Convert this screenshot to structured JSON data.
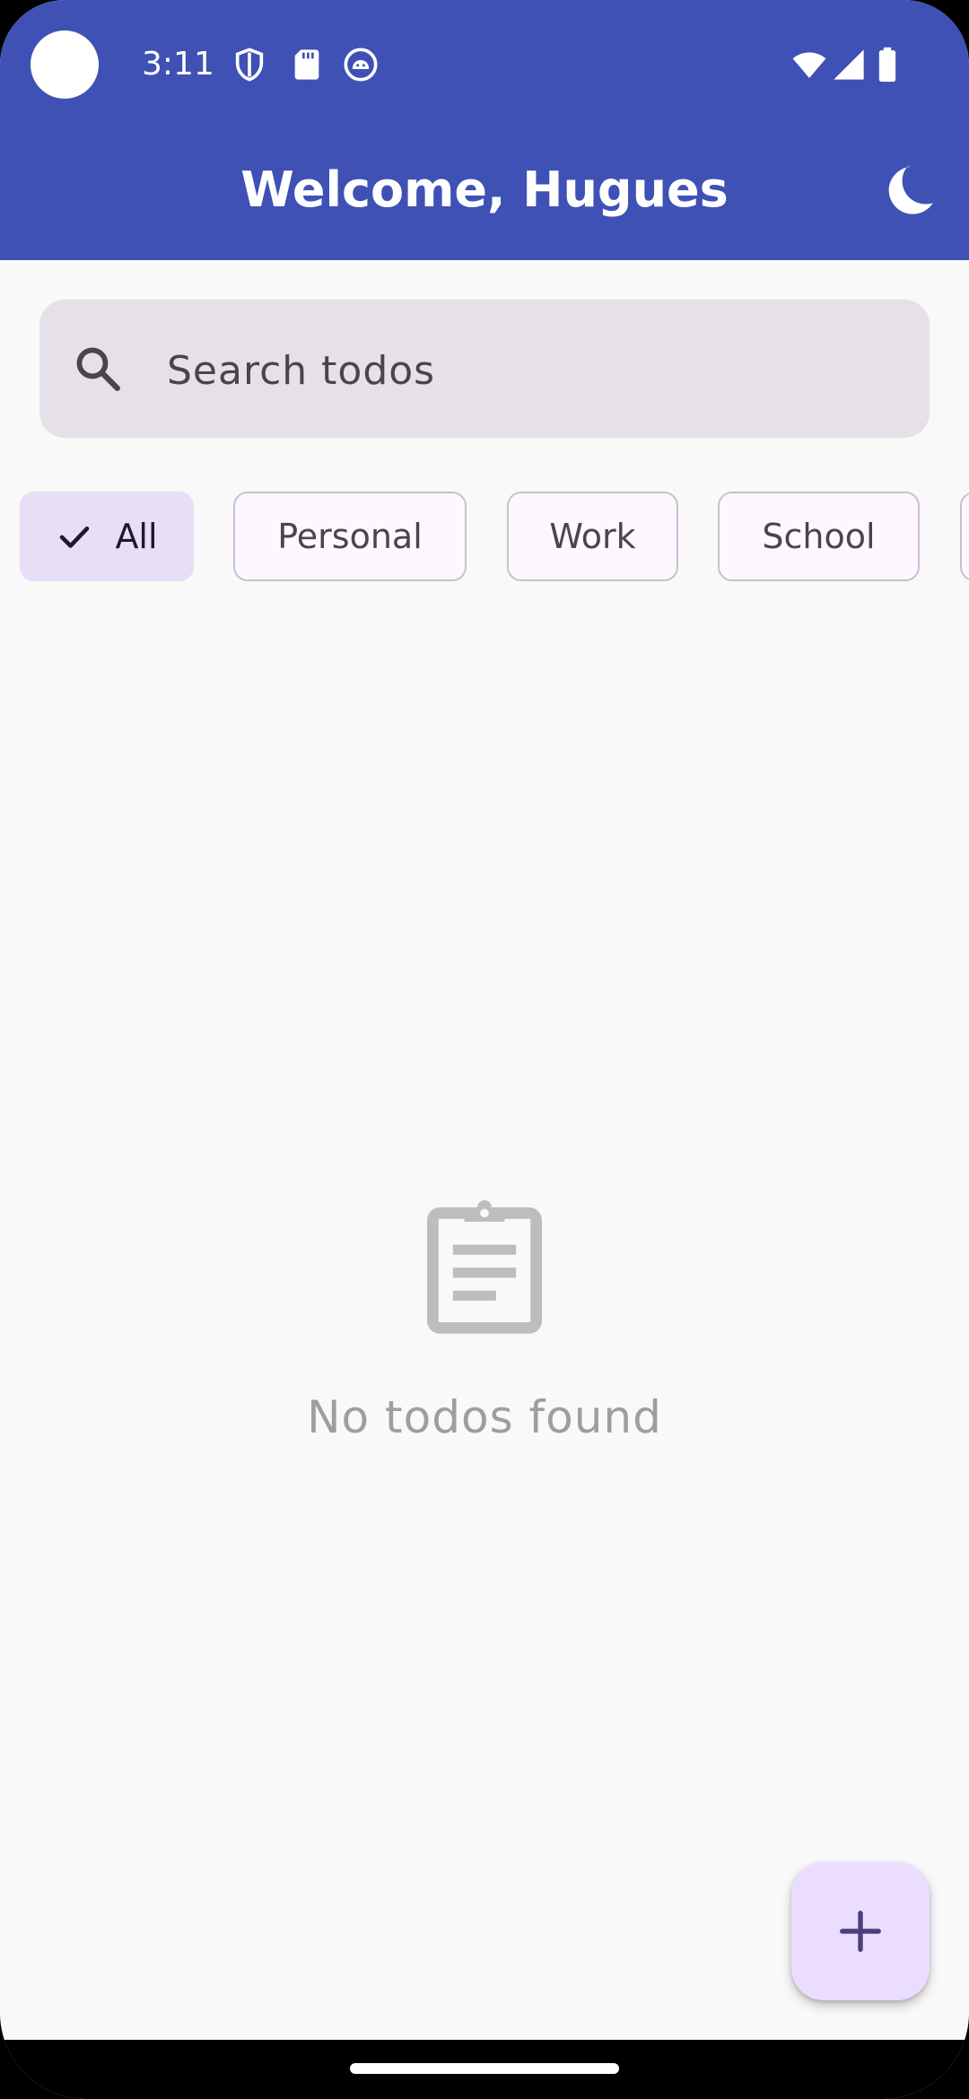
{
  "status_bar": {
    "time": "3:11",
    "left_icons": [
      "shield-icon",
      "sd-card-icon",
      "android-icon"
    ],
    "right_icons": [
      "wifi-icon",
      "cell-signal-icon",
      "battery-icon"
    ]
  },
  "app_bar": {
    "title": "Welcome, Hugues",
    "theme_toggle_icon": "moon-icon",
    "background_color": "#3f51b5"
  },
  "search": {
    "placeholder": "Search todos",
    "value": "",
    "icon": "search-icon"
  },
  "filters": {
    "selected": "All",
    "chips": [
      {
        "label": "All",
        "selected": true
      },
      {
        "label": "Personal",
        "selected": false
      },
      {
        "label": "Work",
        "selected": false
      },
      {
        "label": "School",
        "selected": false
      }
    ]
  },
  "empty_state": {
    "icon": "clipboard-icon",
    "message": "No todos found"
  },
  "fab": {
    "icon": "plus-icon",
    "color": "#eaddff"
  },
  "colors": {
    "primary": "#3f51b5",
    "chip_selected": "#e8def8",
    "search_background": "#e6e0e9",
    "empty_text": "#9e9e9e"
  }
}
